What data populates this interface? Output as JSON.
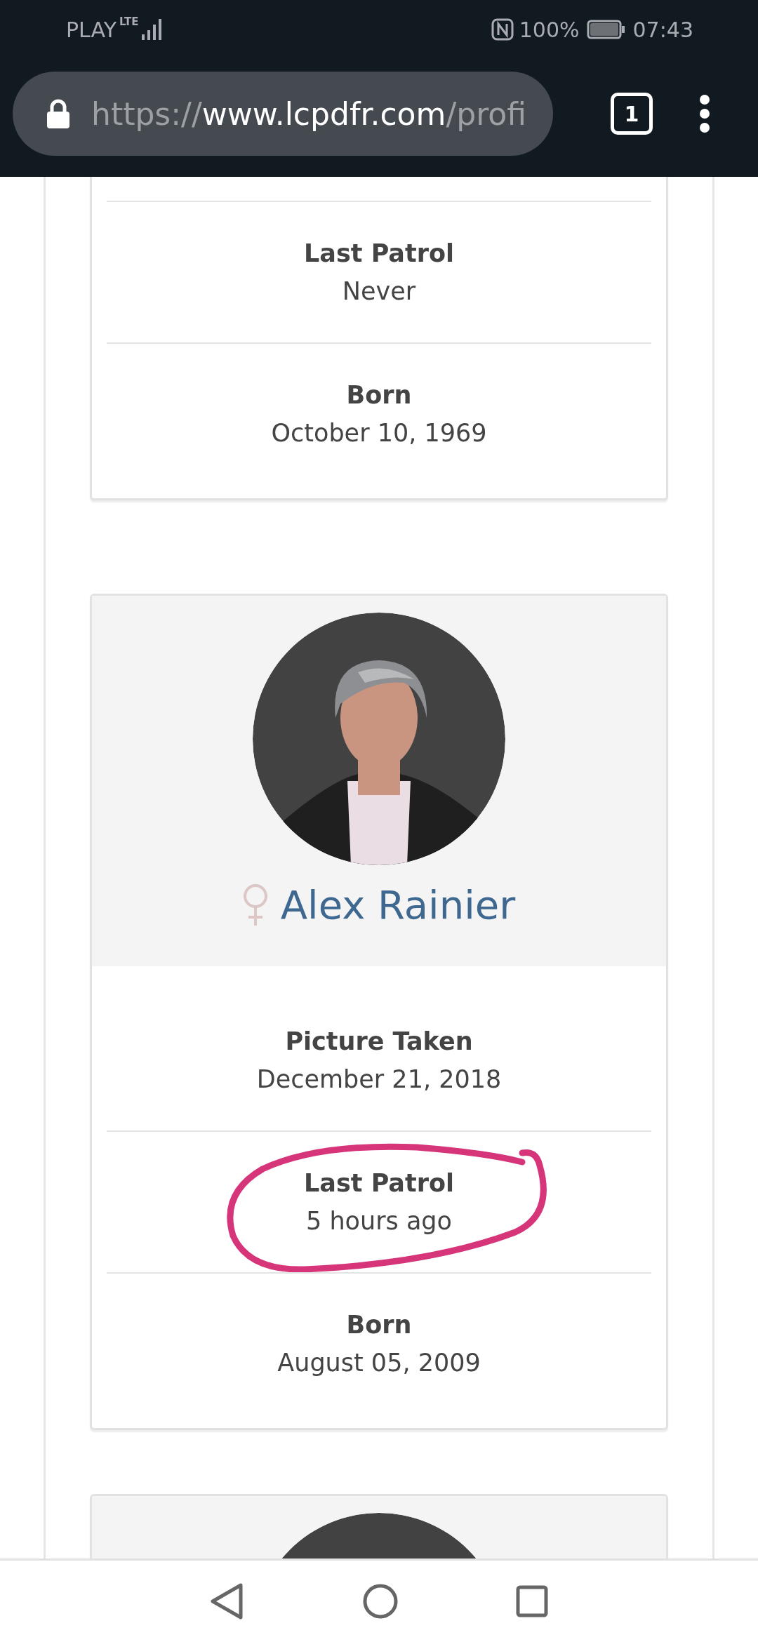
{
  "status_bar": {
    "carrier": "PLAY",
    "network": "LTE",
    "battery": "100%",
    "time": "07:43"
  },
  "browser": {
    "url_scheme": "https://",
    "url_host": "www.lcpdfr.com",
    "url_path": "/profi",
    "tab_count": "1"
  },
  "profiles": [
    {
      "kind": "partial",
      "fields": [
        {
          "label": "Last Patrol",
          "value": "Never"
        },
        {
          "label": "Born",
          "value": "October 10, 1969"
        }
      ]
    },
    {
      "kind": "full",
      "name": "Alex Rainier",
      "fields": [
        {
          "label": "Picture Taken",
          "value": "December 21, 2018"
        },
        {
          "label": "Last Patrol",
          "value": "5 hours ago",
          "circled": true
        },
        {
          "label": "Born",
          "value": "August 05, 2009"
        }
      ]
    },
    {
      "kind": "header_only"
    }
  ]
}
